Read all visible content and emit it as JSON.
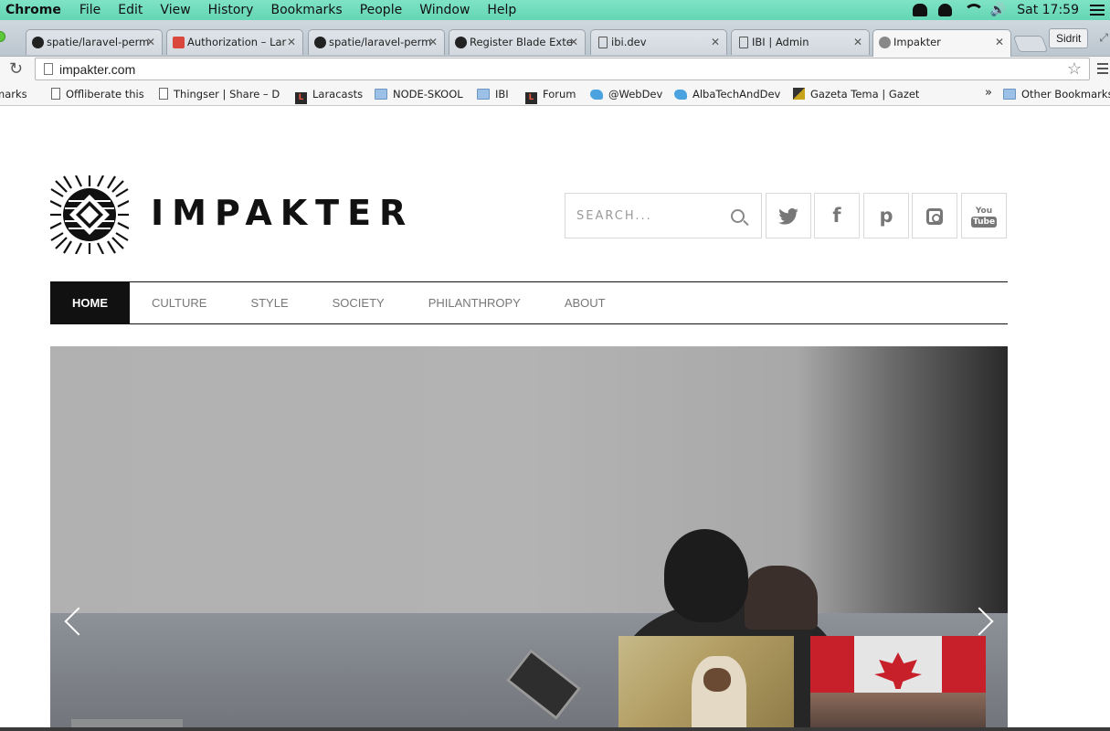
{
  "menubar": {
    "app": "Chrome",
    "items": [
      "File",
      "Edit",
      "View",
      "History",
      "Bookmarks",
      "People",
      "Window",
      "Help"
    ],
    "clock": "Sat 17:59",
    "icons": [
      "bowler-hat-icon",
      "elephant-icon",
      "wifi-icon",
      "volume-icon",
      "list-icon"
    ]
  },
  "tabs": [
    {
      "label": "spatie/laravel-perm",
      "favicon": "github-icon"
    },
    {
      "label": "Authorization – Lar",
      "favicon": "laravel-icon"
    },
    {
      "label": "spatie/laravel-perm",
      "favicon": "github-icon"
    },
    {
      "label": "Register Blade Exte",
      "favicon": "github-icon"
    },
    {
      "label": "ibi.dev",
      "favicon": "page-icon"
    },
    {
      "label": "IBI | Admin",
      "favicon": "page-icon"
    },
    {
      "label": "Impakter",
      "favicon": "gear-icon",
      "active": true
    }
  ],
  "profile": "Sidrit",
  "address": {
    "url": "impakter.com"
  },
  "bookmarks": {
    "items": [
      {
        "label": "marks",
        "icon": "none"
      },
      {
        "label": "Offliberate this",
        "icon": "page"
      },
      {
        "label": "Thingser | Share – D",
        "icon": "page"
      },
      {
        "label": "Laracasts",
        "icon": "laracasts"
      },
      {
        "label": "NODE-SKOOL",
        "icon": "folder"
      },
      {
        "label": "IBI",
        "icon": "folder"
      },
      {
        "label": "Forum",
        "icon": "laracasts"
      },
      {
        "label": "@WebDev",
        "icon": "twitter"
      },
      {
        "label": "AlbaTechAndDev",
        "icon": "twitter"
      },
      {
        "label": "Gazeta Tema | Gazet",
        "icon": "gazeta"
      }
    ],
    "overflow": "»",
    "other": "Other Bookmarks"
  },
  "site": {
    "brand": "IMPAKTER",
    "search_placeholder": "SEARCH...",
    "social": [
      "twitter-icon",
      "facebook-icon",
      "pinterest-icon",
      "instagram-icon",
      "youtube-icon"
    ],
    "social_glyphs": {
      "twitter": "t",
      "facebook": "f",
      "pinterest": "p",
      "youtube_top": "You",
      "youtube_bottom": "Tube"
    },
    "nav": [
      "HOME",
      "CULTURE",
      "STYLE",
      "SOCIETY",
      "PHILANTHROPY",
      "ABOUT"
    ],
    "nav_active": "HOME"
  }
}
